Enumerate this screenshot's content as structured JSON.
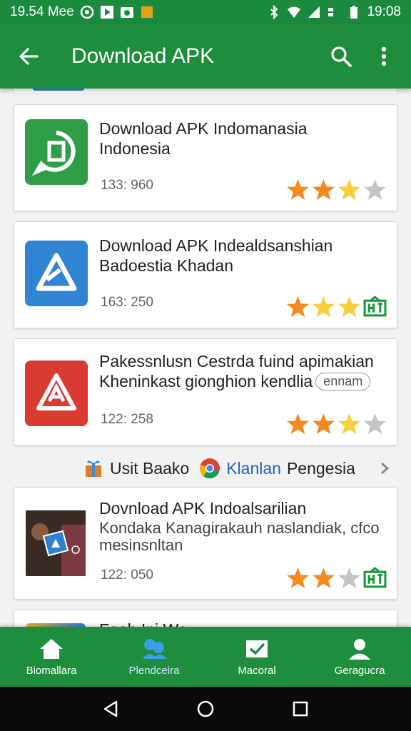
{
  "status_bar": {
    "left_text": "19.54 Mee",
    "time": "19:08",
    "icons": [
      "whatsapp-icon",
      "play-icon",
      "camera-icon",
      "notification-icon"
    ],
    "right_icons": [
      "bluetooth-icon",
      "wifi-icon",
      "signal-icon",
      "data-icon",
      "battery-icon"
    ]
  },
  "app_bar": {
    "title": "Download APK",
    "icons": [
      "back-arrow-icon",
      "search-icon",
      "more-vert-icon"
    ]
  },
  "cards": [
    {
      "title_line1": "Download APK Indomanasia",
      "title_line2": "Indonesia",
      "count": "133: 960",
      "icon_color": "#2e9e48",
      "icon": "chat-app-icon",
      "stars": [
        "full",
        "full",
        "light",
        "empty"
      ],
      "extra_icon": ""
    },
    {
      "title_line1": "Download APK Indealdsanshian",
      "title_line2": "Badoestia Khadan",
      "count": "163: 250",
      "icon_color": "#2f84d4",
      "icon": "triangle-app-icon",
      "stars": [
        "full",
        "light",
        "light"
      ],
      "extra_icon": "gift-box-icon"
    },
    {
      "title_line1": "Pakessnlusn Cestrda fuind apimakian",
      "title_line2": "Kheninkast gionghion kendlia",
      "badge": "ennam",
      "count": "122: 258",
      "icon_color": "#d93a32",
      "icon": "red-triangle-app-icon",
      "stars": [
        "full",
        "full",
        "light",
        "empty"
      ],
      "extra_icon": ""
    },
    {
      "title_line1": "Dovnload APK Indoalsarilian",
      "title_line2": "Kondaka Kanagirakauh naslandiak, cfco",
      "title_line3": "mesinsnltan",
      "count": "122: 050",
      "icon_color": "#2a2a2a",
      "icon": "photo-app-icon",
      "stars": [
        "full",
        "full",
        "empty"
      ],
      "extra_icon": "gift-box-icon"
    }
  ],
  "partial_card": {
    "title_line1": "Fooh Ini Wo"
  },
  "promo": {
    "part1": "Usit Baako",
    "part2": "Klanlan",
    "part3": "Pengesia"
  },
  "bottom_nav": [
    {
      "label": "Biomallara",
      "icon": "home-icon",
      "active": false
    },
    {
      "label": "Plendceira",
      "icon": "people-icon",
      "active": true
    },
    {
      "label": "Macoral",
      "icon": "check-box-icon",
      "active": false
    },
    {
      "label": "Geragucra",
      "icon": "person-icon",
      "active": false
    }
  ],
  "colors": {
    "primary": "#1e8e3e",
    "star_full": "#f28a1d",
    "star_light": "#f7cf3b",
    "star_empty": "#c4c4c4"
  }
}
